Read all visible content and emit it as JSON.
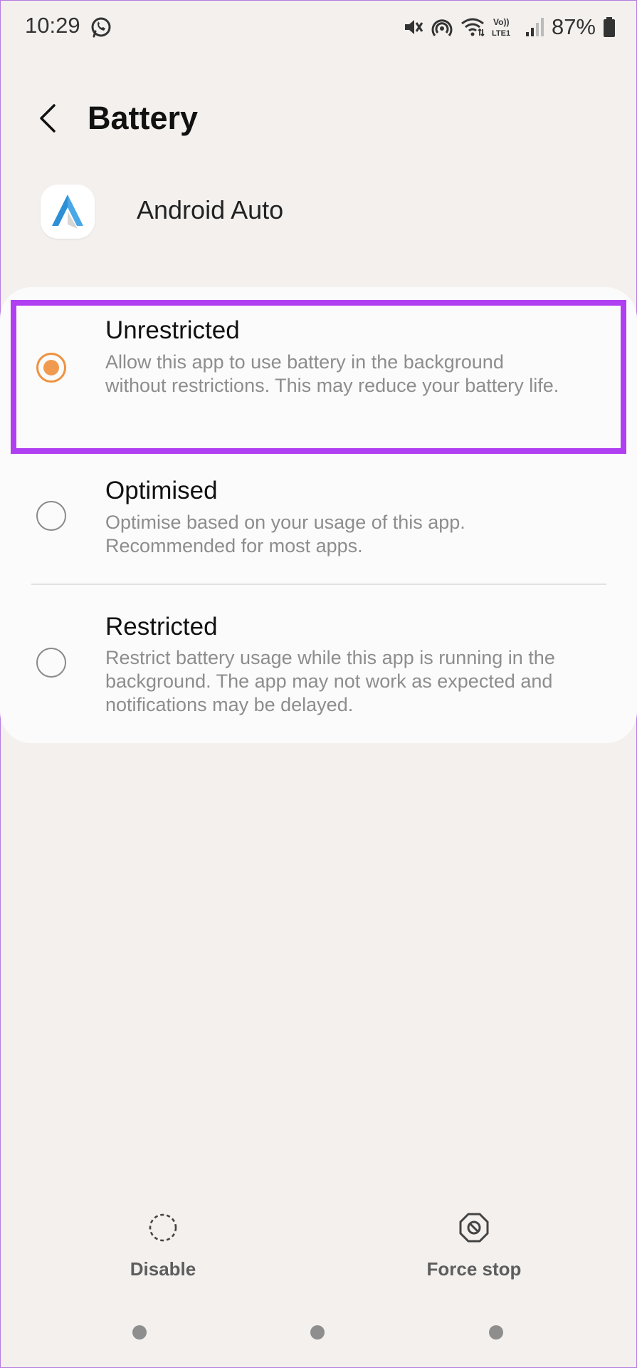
{
  "status_bar": {
    "time": "10:29",
    "battery_percent": "87%",
    "icons": [
      "whatsapp-icon",
      "mute-icon",
      "hotspot-icon",
      "wifi-icon",
      "volte-icon",
      "signal-icon",
      "battery-icon"
    ],
    "volte_text_top": "Vo))",
    "volte_text_bottom": "LTE1"
  },
  "header": {
    "title": "Battery",
    "back_icon": "back-arrow-icon"
  },
  "app": {
    "name": "Android Auto",
    "icon": "android-auto-icon"
  },
  "options": [
    {
      "title": "Unrestricted",
      "description": "Allow this app to use battery in the background without restrictions. This may reduce your battery life.",
      "selected": true
    },
    {
      "title": "Optimised",
      "description": "Optimise based on your usage of this app. Recommended for most apps.",
      "selected": false
    },
    {
      "title": "Restricted",
      "description": "Restrict battery usage while this app is running in the background. The app may not work as expected and notifications may be delayed.",
      "selected": false
    }
  ],
  "bottom_actions": {
    "disable_label": "Disable",
    "force_stop_label": "Force stop"
  },
  "colors": {
    "accent_radio": "#ef9a4f",
    "highlight": "#b03ff2",
    "background": "#f3f0ee",
    "card": "#fbfbfb"
  }
}
